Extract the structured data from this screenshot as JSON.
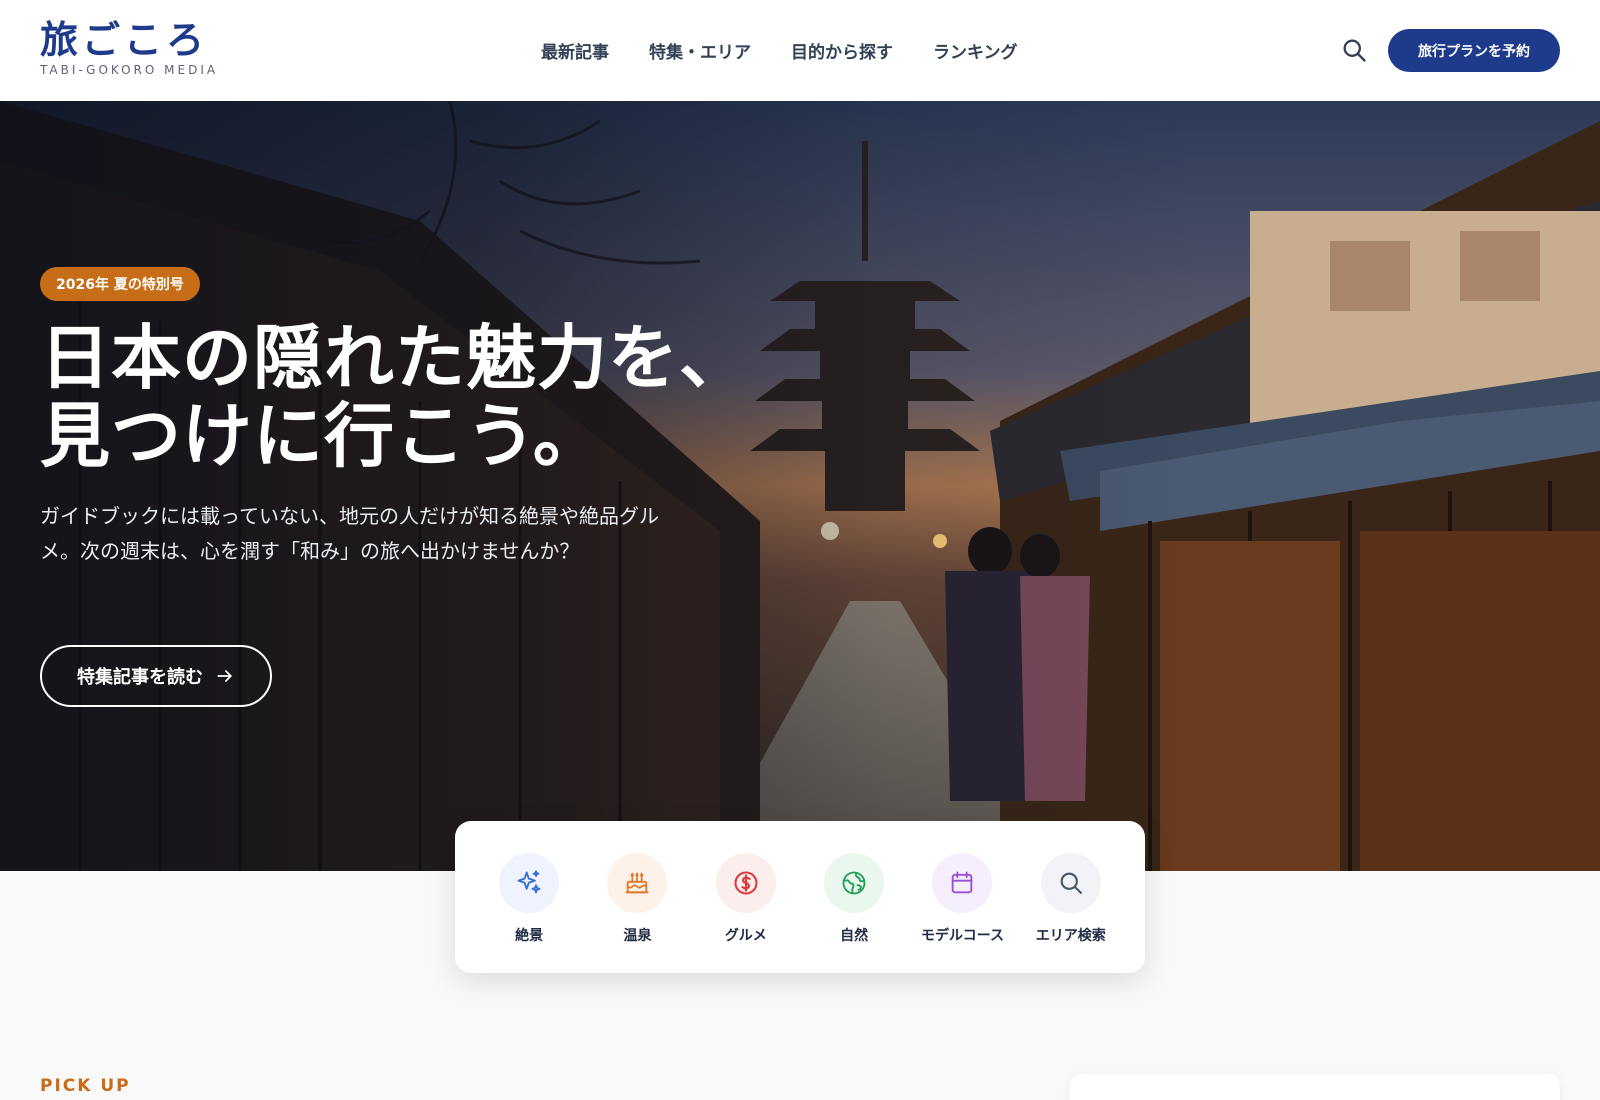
{
  "header": {
    "logo": "旅ごころ",
    "logo_sub": "TABI-GOKORO MEDIA",
    "nav": [
      {
        "label": "最新記事"
      },
      {
        "label": "特集・エリア"
      },
      {
        "label": "目的から探す"
      },
      {
        "label": "ランキング"
      }
    ],
    "search_icon": "search-icon",
    "cta_label": "旅行プランを予約",
    "accent": "#1e3a8a"
  },
  "hero": {
    "badge": "2026年 夏の特別号",
    "badge_color": "#c86d17",
    "title_line1": "日本の隠れた魅力を、",
    "title_line2": "見つけに行こう。",
    "description": "ガイドブックには載っていない、地元の人だけが知る絶景や絶品グルメ。次の週末は、心を潤す「和み」の旅へ出かけませんか？",
    "cta_label": "特集記事を読む",
    "cta_icon": "arrow-right-icon"
  },
  "categories": [
    {
      "label": "絶景",
      "icon": "sparkles-icon",
      "color": "#3b6fd8",
      "bg": "#eef3fd"
    },
    {
      "label": "温泉",
      "icon": "cake-icon",
      "color": "#e07a2e",
      "bg": "#fdf1e8"
    },
    {
      "label": "グルメ",
      "icon": "dollar-icon",
      "color": "#d93a3a",
      "bg": "#fdeeee"
    },
    {
      "label": "自然",
      "icon": "globe-icon",
      "color": "#23a05a",
      "bg": "#eaf7ef"
    },
    {
      "label": "モデルコース",
      "icon": "calendar-icon",
      "color": "#9b4fd8",
      "bg": "#f5eefd"
    },
    {
      "label": "エリア検索",
      "icon": "search-icon",
      "color": "#475569",
      "bg": "#f1f3f6"
    }
  ],
  "pickup": {
    "label": "PICK UP"
  }
}
